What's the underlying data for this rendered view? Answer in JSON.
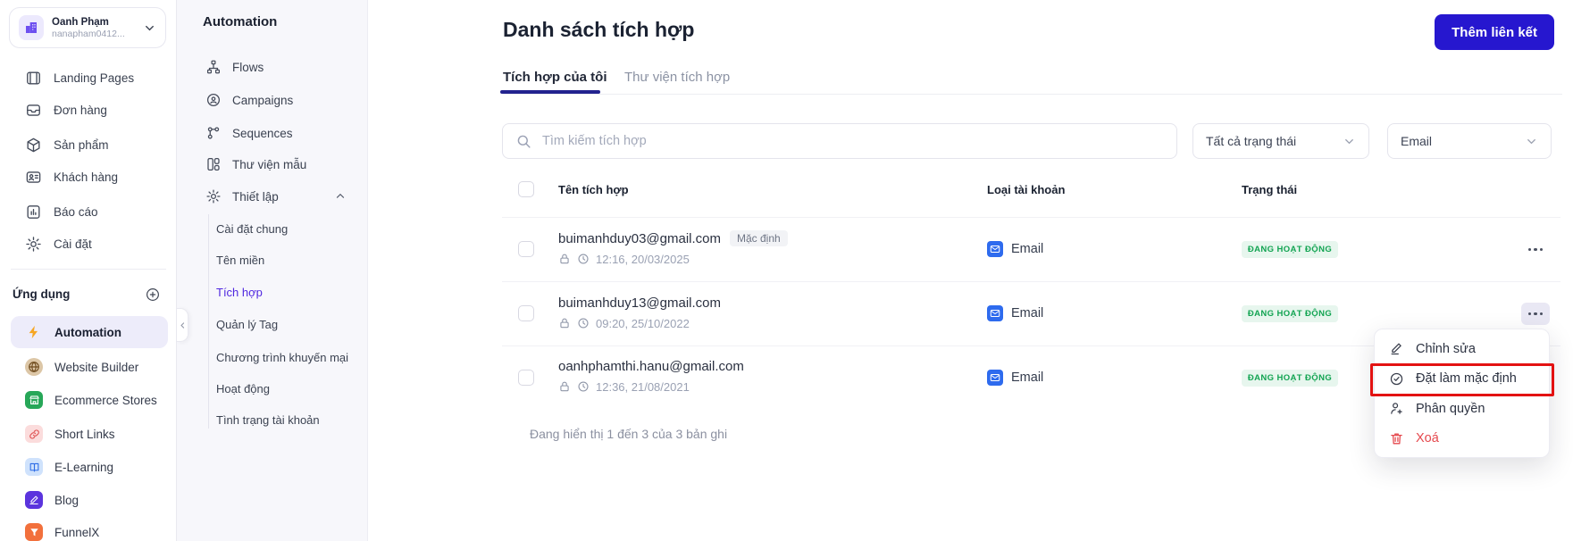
{
  "user": {
    "name": "Oanh Phạm",
    "handle": "nanapham0412..."
  },
  "sidebar": {
    "items": [
      {
        "label": "Landing Pages"
      },
      {
        "label": "Đơn hàng"
      },
      {
        "label": "Sản phẩm"
      },
      {
        "label": "Khách hàng"
      },
      {
        "label": "Báo cáo"
      },
      {
        "label": "Cài đặt"
      }
    ],
    "apps_header": "Ứng dụng",
    "apps": [
      {
        "label": "Automation"
      },
      {
        "label": "Website Builder"
      },
      {
        "label": "Ecommerce Stores"
      },
      {
        "label": "Short Links"
      },
      {
        "label": "E-Learning"
      },
      {
        "label": "Blog"
      },
      {
        "label": "FunnelX"
      }
    ]
  },
  "submenu": {
    "title": "Automation",
    "items": [
      {
        "label": "Flows"
      },
      {
        "label": "Campaigns"
      },
      {
        "label": "Sequences"
      },
      {
        "label": "Thư viện mẫu"
      },
      {
        "label": "Thiết lập"
      }
    ],
    "sub_items": [
      {
        "label": "Cài đặt chung"
      },
      {
        "label": "Tên miền"
      },
      {
        "label": "Tích hợp"
      },
      {
        "label": "Quản lý Tag"
      },
      {
        "label": "Chương trình khuyến mại"
      },
      {
        "label": "Hoạt động"
      },
      {
        "label": "Tình trạng tài khoản"
      }
    ]
  },
  "main": {
    "title": "Danh sách tích hợp",
    "add_button": "Thêm liên kết",
    "tabs": [
      {
        "label": "Tích hợp của tôi"
      },
      {
        "label": "Thư viện tích hợp"
      }
    ],
    "search_placeholder": "Tìm kiếm tích hợp",
    "filters": [
      {
        "value": "Tất cả trạng thái"
      },
      {
        "value": "Email"
      }
    ],
    "table": {
      "headers": {
        "name": "Tên tích hợp",
        "type": "Loại tài khoản",
        "status": "Trạng thái"
      },
      "rows": [
        {
          "email": "buimanhduy03@gmail.com",
          "badge": "Mặc định",
          "time": "12:16, 20/03/2025",
          "type": "Email",
          "status": "ĐANG HOẠT ĐỘNG"
        },
        {
          "email": "buimanhduy13@gmail.com",
          "time": "09:20, 25/10/2022",
          "type": "Email",
          "status": "ĐANG HOẠT ĐỘNG"
        },
        {
          "email": "oanhphamthi.hanu@gmail.com",
          "time": "12:36, 21/08/2021",
          "type": "Email",
          "status": "ĐANG HOẠT ĐỘNG"
        }
      ]
    },
    "footer": "Đang hiển thị 1 đến 3 của 3 bản ghi"
  },
  "context_menu": {
    "items": [
      {
        "label": "Chỉnh sửa"
      },
      {
        "label": "Đặt làm mặc định"
      },
      {
        "label": "Phân quyền"
      },
      {
        "label": "Xoá"
      }
    ]
  },
  "colors": {
    "accent": "#2617cf",
    "active_link": "#5028e0",
    "status_text": "#12a452",
    "status_bg": "#e7f6ee",
    "annotation_red": "#e31212",
    "delete_red": "#e5484d"
  }
}
